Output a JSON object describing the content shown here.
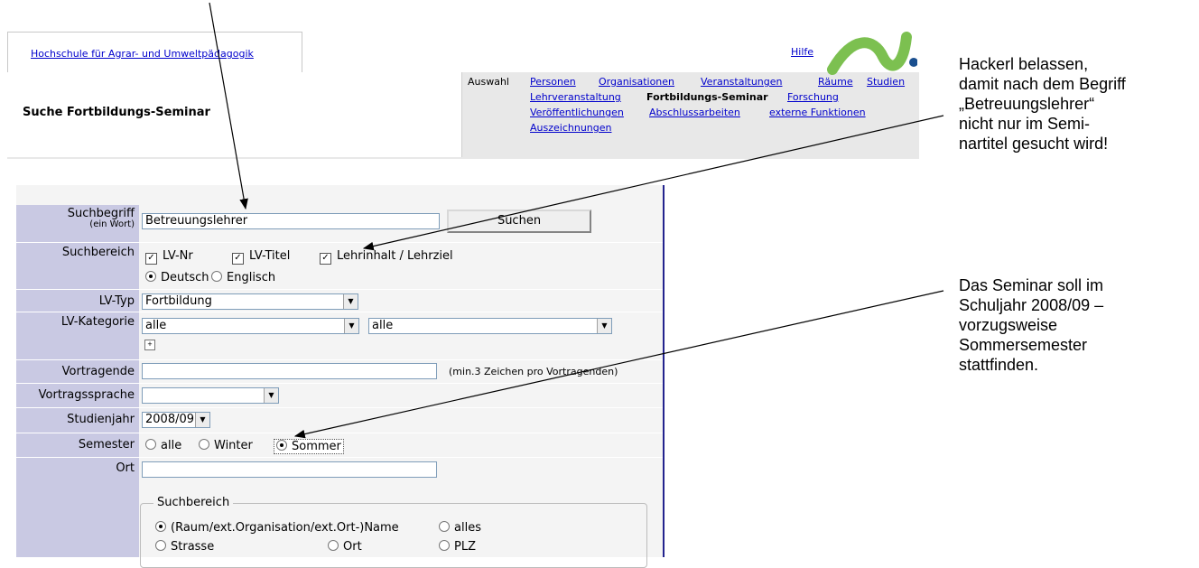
{
  "header": {
    "institution_link": "Hochschule für Agrar- und Umweltpädagogik",
    "help_link": "Hilfe",
    "page_title": "Suche Fortbildungs-Seminar",
    "auswahl_label": "Auswahl",
    "nav": {
      "personen": "Personen",
      "organisationen": "Organisationen",
      "veranstaltungen": "Veranstaltungen",
      "raeume": "Räume",
      "studien": "Studien",
      "lehrveranstaltung": "Lehrveranstaltung",
      "fortbildungs_seminar": "Fortbildungs-Seminar",
      "forschung": "Forschung",
      "veroeffentlichungen": "Veröffentlichungen",
      "abschlussarbeiten": "Abschlussarbeiten",
      "externe_funktionen": "externe Funktionen",
      "auszeichnungen": "Auszeichnungen"
    },
    "colors": {
      "logo_green": "#7cc050",
      "logo_dot": "#1a4f8f",
      "link": "#0000cc",
      "label_bg": "#c9c9e3"
    }
  },
  "form": {
    "suchbegriff": {
      "label": "Suchbegriff",
      "sublabel": "(ein Wort)",
      "value": "Betreuungslehrer"
    },
    "suchen_button": "Suchen",
    "suchbereich": {
      "label": "Suchbereich",
      "lvnr": "LV-Nr",
      "lvtitel": "LV-Titel",
      "lehrinhalt": "Lehrinhalt / Lehrziel",
      "deutsch": "Deutsch",
      "englisch": "Englisch"
    },
    "lvtyp": {
      "label": "LV-Typ",
      "value": "Fortbildung"
    },
    "lvkategorie": {
      "label": "LV-Kategorie",
      "value1": "alle",
      "value2": "alle"
    },
    "vortragende": {
      "label": "Vortragende",
      "value": "",
      "hint": "(min.3 Zeichen pro Vortragenden)"
    },
    "vortragssprache": {
      "label": "Vortragssprache",
      "value": ""
    },
    "studienjahr": {
      "label": "Studienjahr",
      "value": "2008/09"
    },
    "semester": {
      "label": "Semester",
      "alle": "alle",
      "winter": "Winter",
      "sommer": "Sommer"
    },
    "ort": {
      "label": "Ort",
      "value": ""
    },
    "ort_suchbereich": {
      "legend": "Suchbereich",
      "name": "(Raum/ext.Organisation/ext.Ort-)Name",
      "alles": "alles",
      "strasse": "Strasse",
      "ort": "Ort",
      "plz": "PLZ"
    }
  },
  "annotations": {
    "note1": [
      "Hackerl belassen,",
      "damit nach dem Begriff",
      "„Betreuungslehrer“",
      "nicht nur im Semi-",
      "nartitel gesucht wird!"
    ],
    "note2": [
      "Das Seminar soll im",
      "Schuljahr 2008/09 –",
      "vorzugsweise",
      "Sommersemester",
      "stattfinden."
    ]
  }
}
